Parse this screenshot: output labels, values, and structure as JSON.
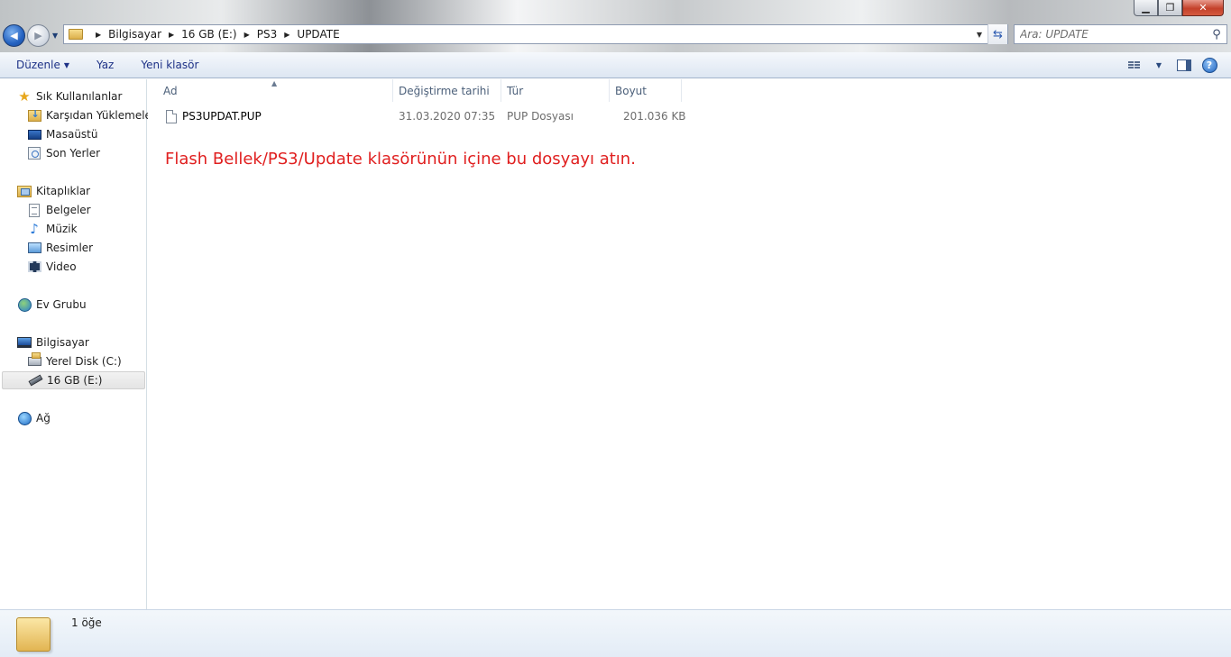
{
  "window": {
    "controls": {
      "minimize": "▁",
      "maximize": "❐",
      "close": "✕"
    }
  },
  "nav": {
    "back_glyph": "◀",
    "forward_glyph": "▶",
    "dropdown_glyph": "▼"
  },
  "address": {
    "breadcrumbs": [
      "Bilgisayar",
      "16 GB (E:)",
      "PS3",
      "UPDATE"
    ],
    "separator_glyph": "▶",
    "dropdown_glyph": "▼",
    "refresh_glyph": "⇆"
  },
  "search": {
    "placeholder": "Ara: UPDATE",
    "icon_glyph": "⚲"
  },
  "toolbar": {
    "organize_label": "Düzenle",
    "organize_caret": "▼",
    "burn_label": "Yaz",
    "new_folder_label": "Yeni klasör",
    "view_caret": "▼",
    "help_glyph": "?"
  },
  "sidebar": {
    "favorites": {
      "label": "Sık Kullanılanlar",
      "items": [
        "Karşıdan Yüklemeler",
        "Masaüstü",
        "Son Yerler"
      ]
    },
    "libraries": {
      "label": "Kitaplıklar",
      "items": [
        "Belgeler",
        "Müzik",
        "Resimler",
        "Video"
      ]
    },
    "homegroup": {
      "label": "Ev Grubu"
    },
    "computer": {
      "label": "Bilgisayar",
      "items": [
        "Yerel Disk (C:)",
        "16 GB (E:)"
      ]
    },
    "network": {
      "label": "Ağ"
    },
    "icons": {
      "star": "★",
      "music": "♪"
    }
  },
  "columns": {
    "name": "Ad",
    "date": "Değiştirme tarihi",
    "type": "Tür",
    "size": "Boyut",
    "sort_glyph": "▲"
  },
  "files": [
    {
      "name": "PS3UPDAT.PUP",
      "date": "31.03.2020 07:35",
      "type": "PUP Dosyası",
      "size": "201.036 KB"
    }
  ],
  "note": "Flash Bellek/PS3/Update klasörünün içine bu dosyayı atın.",
  "note_color": "#e01f1f",
  "status": {
    "item_count": "1 öğe"
  }
}
